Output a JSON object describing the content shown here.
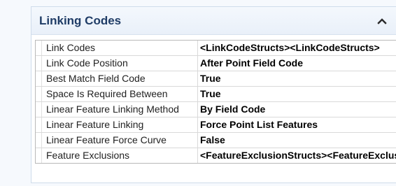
{
  "section": {
    "title": "Linking Codes",
    "collapse_icon": "chevron-up-icon"
  },
  "properties": [
    {
      "name": "Link Codes",
      "value": "<LinkCodeStructs><LinkCodeStructs>"
    },
    {
      "name": "Link Code Position",
      "value": "After Point Field Code"
    },
    {
      "name": "Best Match Field Code",
      "value": "True"
    },
    {
      "name": "Space Is Required Between",
      "value": "True"
    },
    {
      "name": "Linear Feature Linking Method",
      "value": "By Field Code"
    },
    {
      "name": "Linear Feature Linking",
      "value": "Force Point List Features"
    },
    {
      "name": "Linear Feature Force Curve",
      "value": "False"
    },
    {
      "name": "Feature Exclusions",
      "value": "<FeatureExclusionStructs><FeatureExclusionStructs>"
    }
  ],
  "colors": {
    "header_text": "#1f3c66",
    "header_bg": "#eef3fa",
    "grid_line": "#d9d9d9"
  }
}
